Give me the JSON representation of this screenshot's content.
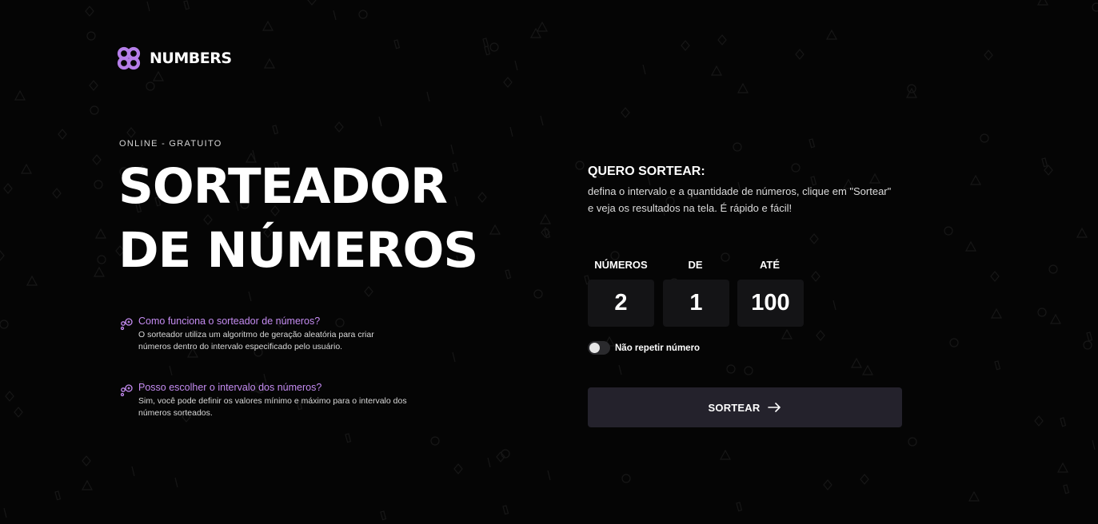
{
  "brand": {
    "name": "NUMBERS",
    "accent_color": "#b57ee8"
  },
  "hero": {
    "eyebrow": "ONLINE - GRATUITO",
    "title_line1": "SORTEADOR",
    "title_line2": "DE NÚMEROS"
  },
  "faq": [
    {
      "question": "Como funciona o sorteador de números?",
      "answer": "O sorteador utiliza um algoritmo de geração aleatória para criar números dentro do intervalo especificado pelo usuário."
    },
    {
      "question": "Posso escolher o intervalo dos números?",
      "answer": "Sim, você pode definir os valores mínimo e máximo para o intervalo dos números sorteados."
    }
  ],
  "panel": {
    "heading": "QUERO SORTEAR:",
    "description": "defina o intervalo e a quantidade de números, clique em \"Sortear\" e veja os resultados na tela. É rápido e fácil!"
  },
  "fields": [
    {
      "label": "NÚMEROS",
      "value": "2"
    },
    {
      "label": "DE",
      "value": "1"
    },
    {
      "label": "ATÉ",
      "value": "100"
    }
  ],
  "toggle": {
    "label": "Não repetir número",
    "checked": false
  },
  "submit": {
    "label": "SORTEAR",
    "icon": "arrow-right-icon"
  },
  "colors": {
    "background": "#050505",
    "field_background": "#141416",
    "button_background": "#24222c",
    "question_color": "#c58cf2"
  }
}
